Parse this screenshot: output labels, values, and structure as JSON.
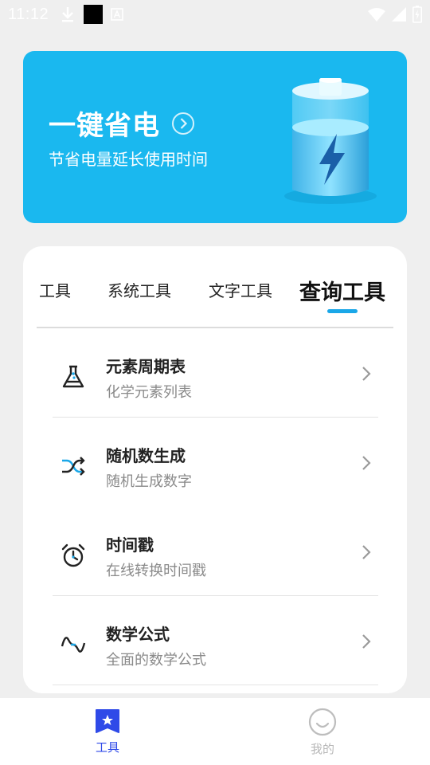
{
  "status_bar": {
    "time": "11:12",
    "left_icons": [
      "download-icon",
      "black-square-icon",
      "a-box-icon"
    ],
    "right_icons": [
      "wifi-icon",
      "signal-icon",
      "battery-charging-icon"
    ]
  },
  "banner": {
    "title": "一键省电",
    "subtitle": "节省电量延长使用时间",
    "background_color": "#1ab8ef"
  },
  "tabs": [
    {
      "label": "工具",
      "active": false
    },
    {
      "label": "系统工具",
      "active": false
    },
    {
      "label": "文字工具",
      "active": false
    },
    {
      "label": "查询工具",
      "active": true
    }
  ],
  "tools": [
    {
      "name": "元素周期表",
      "desc": "化学元素列表",
      "icon": "flask-icon"
    },
    {
      "name": "随机数生成",
      "desc": "随机生成数字",
      "icon": "shuffle-icon"
    },
    {
      "name": "时间戳",
      "desc": "在线转换时间戳",
      "icon": "alarm-clock-icon"
    },
    {
      "name": "数学公式",
      "desc": "全面的数学公式",
      "icon": "sine-wave-icon"
    }
  ],
  "bottom_nav": [
    {
      "label": "工具",
      "icon": "star-bookmark-icon",
      "active": true
    },
    {
      "label": "我的",
      "icon": "smiley-icon",
      "active": false
    }
  ],
  "colors": {
    "accent": "#1aa7e8",
    "nav_active": "#2f4ae8",
    "nav_inactive": "#b8b8b8"
  }
}
